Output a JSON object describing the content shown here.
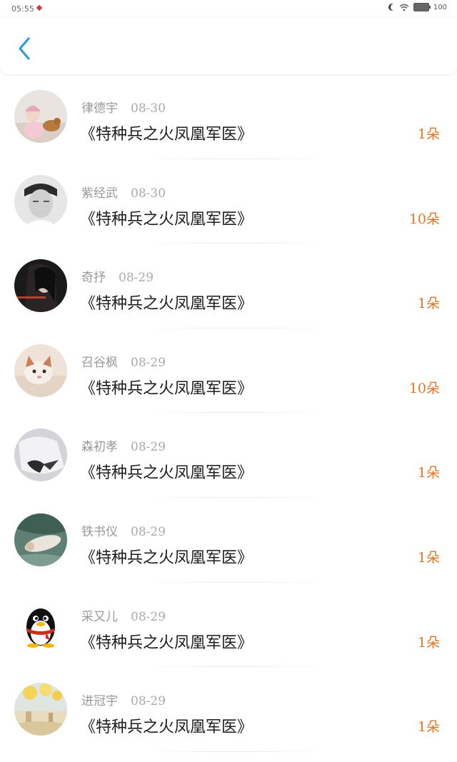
{
  "status_bar": {
    "time": "05:55",
    "battery": "100"
  },
  "records": [
    {
      "name": "律德宇",
      "date": "08-30",
      "book": "《特种兵之火凤凰军医》",
      "amount": "1朵",
      "avatar": "avatar-child-photo"
    },
    {
      "name": "紫经武",
      "date": "08-30",
      "book": "《特种兵之火凤凰军医》",
      "amount": "10朵",
      "avatar": "avatar-man-photo"
    },
    {
      "name": "奇抒",
      "date": "08-29",
      "book": "《特种兵之火凤凰军医》",
      "amount": "1朵",
      "avatar": "avatar-woman-dark-photo"
    },
    {
      "name": "召谷枫",
      "date": "08-29",
      "book": "《特种兵之火凤凰军医》",
      "amount": "10朵",
      "avatar": "avatar-cat-photo"
    },
    {
      "name": "森初孝",
      "date": "08-29",
      "book": "《特种兵之火凤凰军医》",
      "amount": "1朵",
      "avatar": "avatar-cloth-photo"
    },
    {
      "name": "铁书仪",
      "date": "08-29",
      "book": "《特种兵之火凤凰军医》",
      "amount": "1朵",
      "avatar": "avatar-water-photo"
    },
    {
      "name": "采又儿",
      "date": "08-29",
      "book": "《特种兵之火凤凰军医》",
      "amount": "1朵",
      "avatar": "penguin-icon"
    },
    {
      "name": "进冠宇",
      "date": "08-29",
      "book": "《特种兵之火凤凰军医》",
      "amount": "1朵",
      "avatar": "avatar-beach-photo"
    }
  ],
  "colors": {
    "accent_back": "#2d9bdb",
    "amount": "#e0762a"
  }
}
